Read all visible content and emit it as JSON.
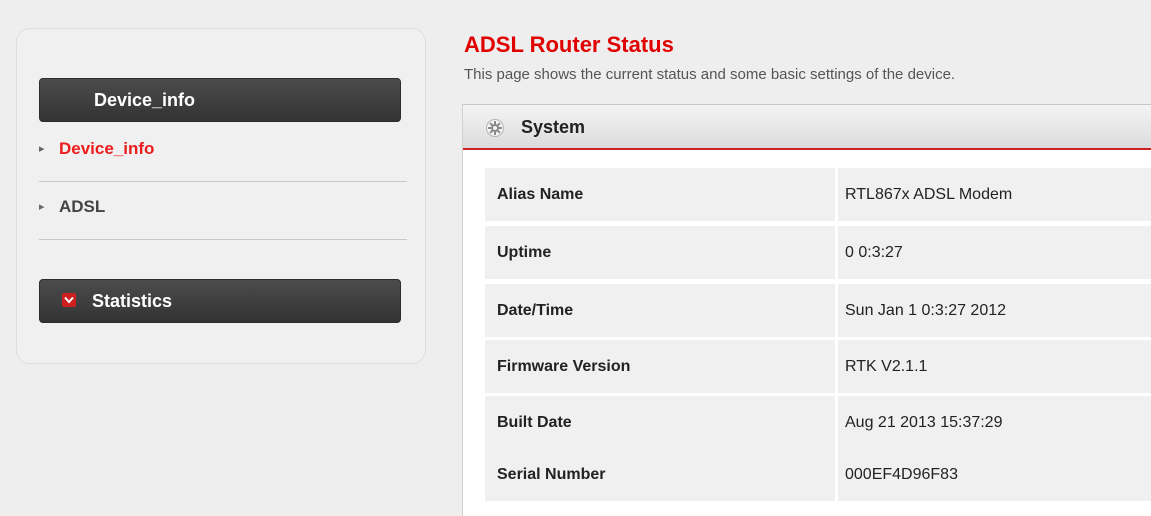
{
  "sidebar": {
    "device_header": "Device_info",
    "items": [
      {
        "label": "Device_info"
      },
      {
        "label": "ADSL"
      }
    ],
    "stats_header": "Statistics"
  },
  "page": {
    "title": "ADSL Router Status",
    "description": "This page shows the current status and some basic settings of the device."
  },
  "panel": {
    "title": "System",
    "rows": [
      {
        "label": "Alias Name",
        "value": "RTL867x ADSL Modem"
      },
      {
        "label": "Uptime",
        "value": "0 0:3:27"
      },
      {
        "label": "Date/Time",
        "value": "Sun Jan 1 0:3:27 2012"
      },
      {
        "label": "Firmware Version",
        "value": "RTK V2.1.1"
      },
      {
        "label": "Built Date",
        "value": "Aug 21 2013 15:37:29"
      },
      {
        "label": "Serial Number",
        "value": "000EF4D96F83"
      }
    ]
  },
  "colors": {
    "accent_red": "#e00000",
    "menu_dark": "#3d3d3d"
  },
  "icons": {
    "menu_arrow": "chevron-right-icon",
    "stats_toggle": "chevron-down-icon",
    "panel": "gear-icon"
  }
}
